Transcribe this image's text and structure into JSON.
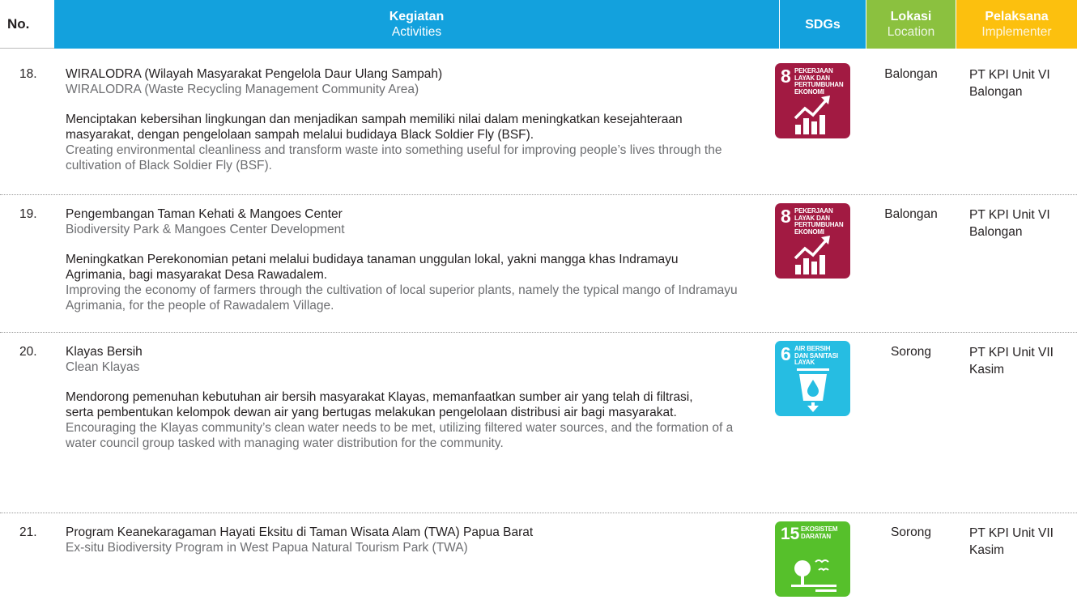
{
  "header": {
    "no": "No.",
    "activities_id": "Kegiatan",
    "activities_en": "Activities",
    "sdgs": "SDGs",
    "location_id": "Lokasi",
    "location_en": "Location",
    "implementer_id": "Pelaksana",
    "implementer_en": "Implementer"
  },
  "colors": {
    "activities_header": "#13a1dd",
    "location_header": "#8bc13f",
    "implementer_header": "#fcc00e",
    "sdg8": "#a21a42",
    "sdg6": "#26bde2",
    "sdg15": "#56c02b"
  },
  "rows": [
    {
      "no": "18.",
      "title_id": "WIRALODRA (Wilayah Masyarakat Pengelola Daur Ulang Sampah)",
      "title_en": "WIRALODRA (Waste Recycling Management Community Area)",
      "desc_id": "Menciptakan kebersihan lingkungan dan menjadikan sampah memiliki nilai dalam meningkatkan kesejahteraan masyarakat, dengan pengelolaan sampah melalui budidaya Black Soldier Fly (BSF).",
      "desc_en": "Creating environmental cleanliness and transform waste into something useful for improving people’s lives through the cultivation of Black Soldier Fly (BSF).",
      "sdg": {
        "number": "8",
        "label": "PEKERJAAN LAYAK DAN PERTUMBUHAN EKONOMI",
        "icon": "growth-chart-icon"
      },
      "location": "Balongan",
      "implementer": "PT KPI Unit VI Balongan"
    },
    {
      "no": "19.",
      "title_id": "Pengembangan Taman Kehati & Mangoes Center",
      "title_en": "Biodiversity Park & Mangoes Center Development",
      "desc_id": "Meningkatkan Perekonomian petani melalui budidaya tanaman unggulan lokal, yakni mangga khas Indramayu Agrimania, bagi masyarakat Desa Rawadalem.",
      "desc_en": "Improving the economy of farmers through the cultivation of local superior plants, namely the typical mango of Indramayu Agrimania, for the people of Rawadalem Village.",
      "sdg": {
        "number": "8",
        "label": "PEKERJAAN LAYAK DAN PERTUMBUHAN EKONOMI",
        "icon": "growth-chart-icon"
      },
      "location": "Balongan",
      "implementer": "PT KPI Unit VI Balongan"
    },
    {
      "no": "20.",
      "title_id": "Klayas Bersih",
      "title_en": "Clean Klayas",
      "desc_id": "Mendorong pemenuhan kebutuhan air bersih masyarakat Klayas, memanfaatkan sumber air yang telah di filtrasi, serta pembentukan kelompok dewan air yang bertugas melakukan pengelolaan distribusi air bagi masyarakat.",
      "desc_en": "Encouraging the Klayas community’s clean water needs to be met, utilizing filtered water sources, and the formation of a water council group tasked with managing water distribution for the community.",
      "sdg": {
        "number": "6",
        "label": "AIR BERSIH DAN SANITASI LAYAK",
        "icon": "water-glass-icon"
      },
      "location": "Sorong",
      "implementer": "PT KPI Unit VII Kasim"
    },
    {
      "no": "21.",
      "title_id": "Program Keanekaragaman Hayati Eksitu di Taman Wisata Alam (TWA) Papua Barat",
      "title_en": "Ex-situ Biodiversity Program in West Papua Natural Tourism Park (TWA)",
      "desc_id": "",
      "desc_en": "",
      "sdg": {
        "number": "15",
        "label": "EKOSISTEM DARATAN",
        "icon": "tree-birds-icon"
      },
      "location": "Sorong",
      "implementer": "PT KPI Unit VII Kasim"
    }
  ]
}
